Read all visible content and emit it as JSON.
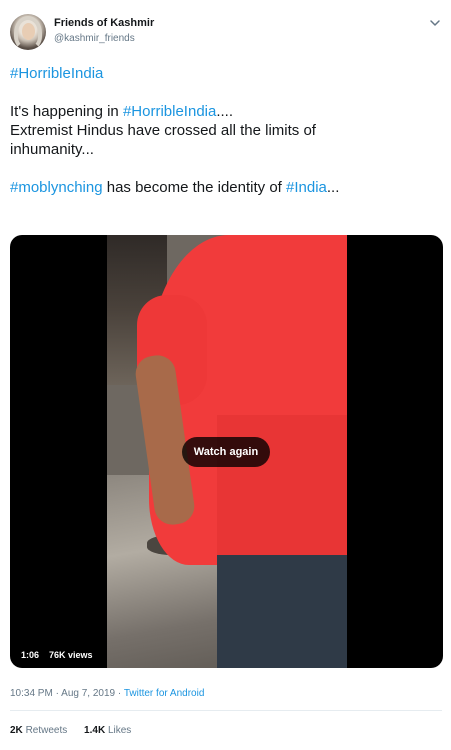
{
  "author": {
    "display_name": "Friends of Kashmir",
    "handle": "@kashmir_friends",
    "avatar_icon": "profile-avatar"
  },
  "menu": {
    "icon": "chevron-down-icon"
  },
  "tweet": {
    "line1_tag": "#HorribleIndia",
    "line2_prefix": "It's happening in ",
    "line2_tag": "#HorribleIndia",
    "line2_suffix": "....",
    "line3": "Extremist Hindus have crossed all the limits of",
    "line4": "inhumanity...",
    "line5_tag1": "#moblynching",
    "line5_middle": " has become the identity of ",
    "line5_tag2": "#India",
    "line5_suffix": "..."
  },
  "video": {
    "watch_again_label": "Watch again",
    "duration": "1:06",
    "views": "76K views"
  },
  "meta": {
    "time": "10:34 PM",
    "separator": " · ",
    "date": "Aug 7, 2019",
    "source": "Twitter for Android"
  },
  "stats": {
    "retweets_count": "2K",
    "retweets_label": "Retweets",
    "likes_count": "1.4K",
    "likes_label": "Likes"
  },
  "colors": {
    "link": "#1b95e0",
    "text": "#14171a",
    "secondary": "#657786",
    "shirt": "#f13b3b"
  }
}
